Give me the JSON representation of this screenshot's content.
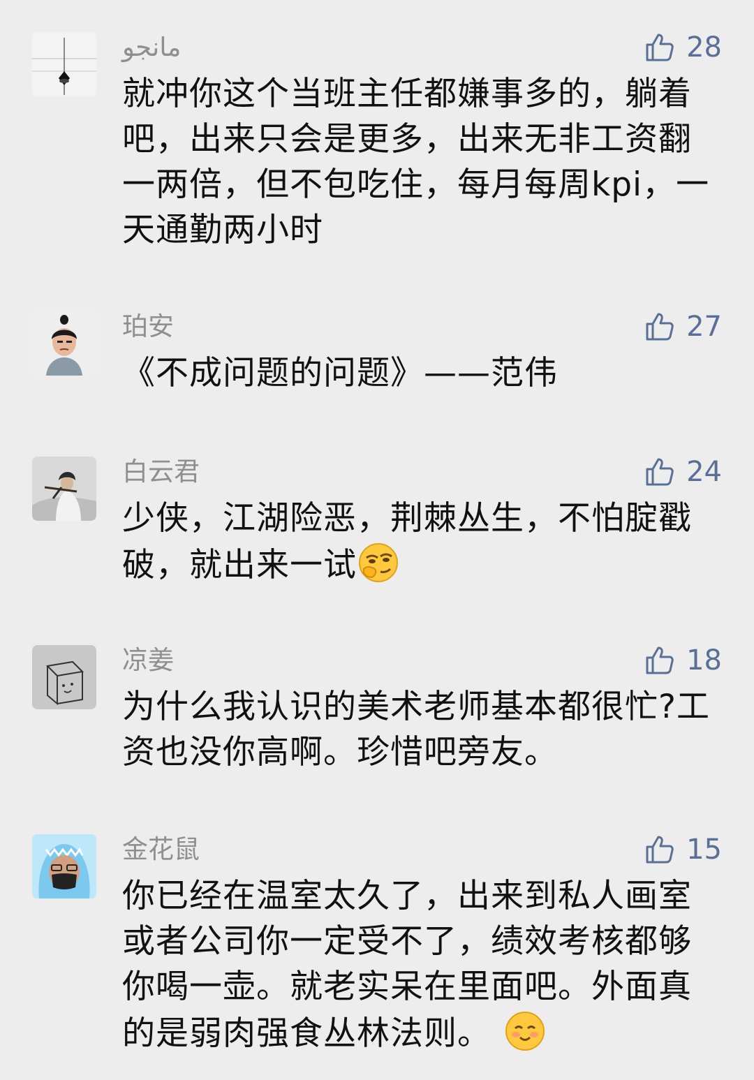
{
  "comments": [
    {
      "username": "مانجو",
      "likes": "28",
      "text": "就冲你这个当班主任都嫌事多的，躺着吧，出来只会是更多，出来无非工资翻一两倍，但不包吃住，每月每周kpi，一天通勤两小时",
      "avatar_icon": "ink-landscape-avatar",
      "like_icon": "thumb-up-icon"
    },
    {
      "username": "珀安",
      "likes": "27",
      "text": "《不成问题的问题》——范伟",
      "avatar_icon": "cartoon-boy-avatar",
      "like_icon": "thumb-up-icon"
    },
    {
      "username": "白云君",
      "likes": "24",
      "text": "少侠，江湖险恶，荆棘丛生，不怕腚戳破，就出来一试",
      "avatar_icon": "swordsman-avatar",
      "like_icon": "thumb-up-icon",
      "trailing_emoji": "peeking-emoji"
    },
    {
      "username": "凉姜",
      "likes": "18",
      "text": "为什么我认识的美术老师基本都很忙?工资也没你高啊。珍惜吧旁友。",
      "avatar_icon": "sketched-cube-avatar",
      "like_icon": "thumb-up-icon"
    },
    {
      "username": "金花鼠",
      "likes": "15",
      "text": "你已经在温室太久了，出来到私人画室或者公司你一定受不了，绩效考核都够你喝一壶。就老实呆在里面吧。外面真的是弱肉强食丛林法则。",
      "avatar_icon": "shark-hood-avatar",
      "like_icon": "thumb-up-icon",
      "trailing_emoji": "smiling-blush-emoji"
    }
  ],
  "colors": {
    "background": "#ededed",
    "username": "#8f8f8f",
    "like": "#5a6f96",
    "text": "#111111"
  }
}
